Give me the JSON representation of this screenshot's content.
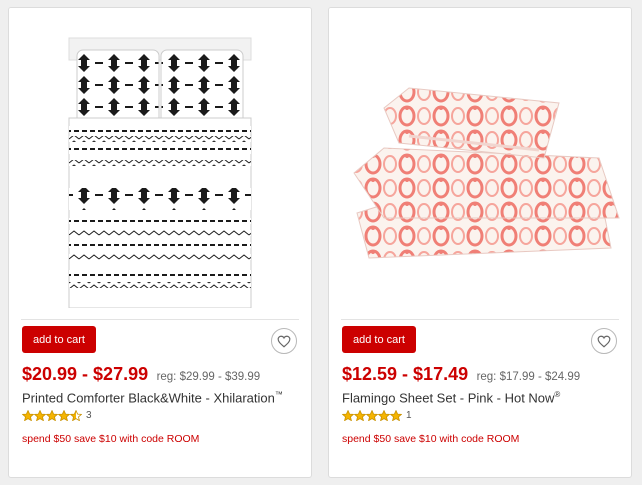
{
  "products": [
    {
      "image_alt": "comforter-image",
      "add_to_cart": "add to cart",
      "price": "$20.99 - $27.99",
      "reg_price": "reg: $29.99 - $39.99",
      "title": "Printed Comforter Black&White - Xhilaration",
      "title_mark": "™",
      "rating": 4.5,
      "review_count": "3",
      "promo": "spend $50 save $10 with code ROOM"
    },
    {
      "image_alt": "flamingo-sheet-set-image",
      "add_to_cart": "add to cart",
      "price": "$12.59 - $17.49",
      "reg_price": "reg: $17.99 - $24.99",
      "title": "Flamingo Sheet Set - Pink - Hot Now",
      "title_mark": "®",
      "rating": 5,
      "review_count": "1",
      "promo": "spend $50 save $10 with code ROOM"
    }
  ],
  "colors": {
    "price_red": "#cc0000",
    "star_gold": "#f5b400",
    "pattern_black": "#1a1a1a",
    "flamingo_pink": "#f07f76"
  },
  "icons": [
    "heart-icon",
    "star-icon"
  ]
}
